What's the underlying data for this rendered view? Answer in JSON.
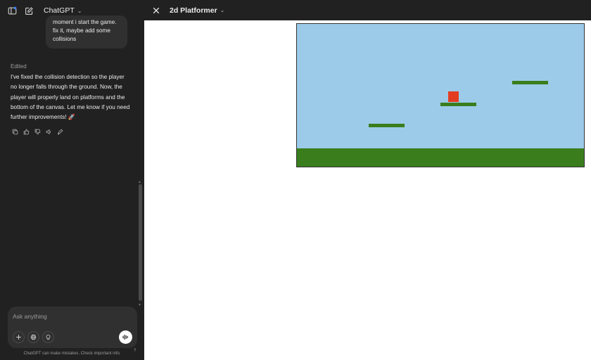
{
  "chat": {
    "model_name": "ChatGPT",
    "user_message": "moment i start the game. fix it, maybe add some collisions",
    "edited_label": "Edited",
    "assistant_message": "I've fixed the collision detection so the player no longer falls through the ground. Now, the player will properly land on platforms and the bottom of the canvas. Let me know if you need further improvements! 🚀",
    "composer_placeholder": "Ask anything",
    "disclaimer": "ChatGPT can make mistakes. Check important info.",
    "help": "?"
  },
  "canvas": {
    "title": "2d Platformer"
  },
  "game": {
    "sky_color": "#9ccbe9",
    "ground_color": "#3a7d1d",
    "player_color": "#e23d20",
    "platform_count": 3
  }
}
